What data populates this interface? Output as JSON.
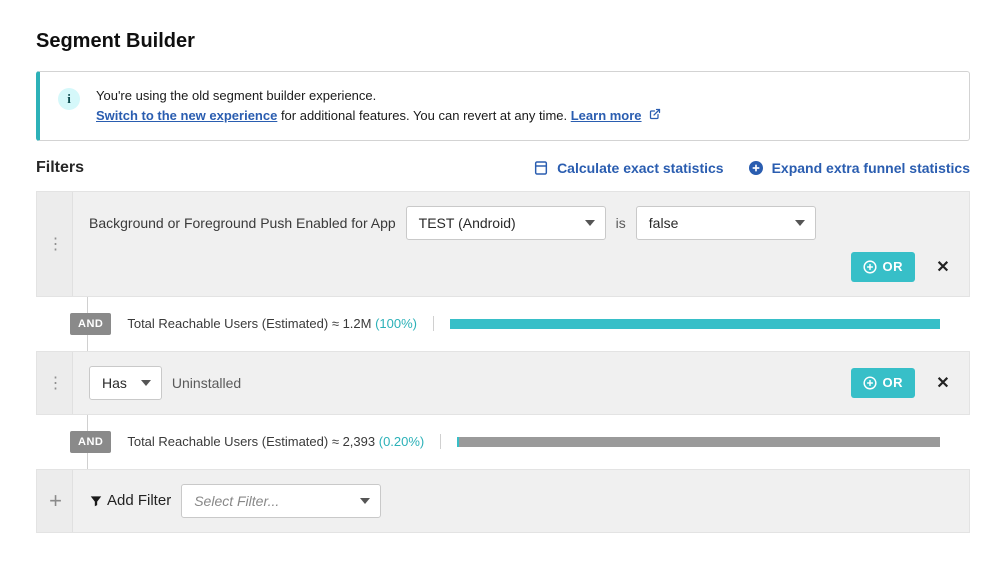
{
  "page": {
    "title": "Segment Builder"
  },
  "notice": {
    "line1": "You're using the old segment builder experience.",
    "switch_link": "Switch to the new experience",
    "line2_tail": " for additional features. You can revert at any time. ",
    "learn_more": "Learn more"
  },
  "filters_header": {
    "title": "Filters",
    "calc_stats": "Calculate exact statistics",
    "expand_stats": "Expand extra funnel statistics"
  },
  "filter1": {
    "label": "Background or Foreground Push Enabled for App",
    "app_select": "TEST (Android)",
    "is_word": "is",
    "value_select": "false",
    "or_label": "OR"
  },
  "and1": {
    "chip": "AND",
    "reach_prefix": "Total Reachable Users (Estimated) ≈ ",
    "reach_value": "1.2M",
    "reach_pct": "(100%)"
  },
  "filter2": {
    "has_select": "Has",
    "status_text": "Uninstalled",
    "or_label": "OR"
  },
  "and2": {
    "chip": "AND",
    "reach_prefix": "Total Reachable Users (Estimated) ≈ ",
    "reach_value": "2,393",
    "reach_pct": "(0.20%)"
  },
  "add_filter": {
    "label": "Add Filter",
    "placeholder": "Select Filter..."
  }
}
